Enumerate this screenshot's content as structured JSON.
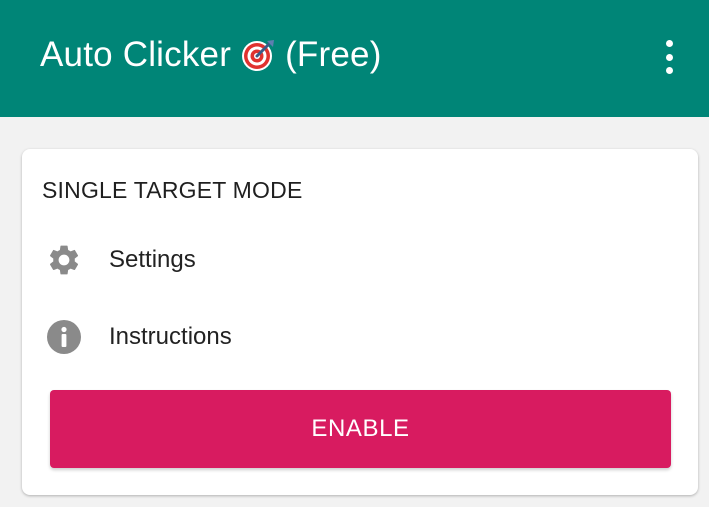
{
  "app_bar": {
    "title_prefix": "Auto Clicker",
    "title_suffix": "(Free)",
    "title_icon": "direct-hit-target-icon",
    "overflow_icon": "more-vert-icon",
    "background_color": "#008577"
  },
  "card": {
    "title": "SINGLE TARGET MODE",
    "items": [
      {
        "icon": "gear-icon",
        "label": "Settings"
      },
      {
        "icon": "info-icon",
        "label": "Instructions"
      }
    ],
    "enable_button": {
      "label": "ENABLE",
      "color": "#d81b60"
    }
  },
  "colors": {
    "background": "#f2f2f2",
    "icon_gray": "#8a8a8a"
  }
}
